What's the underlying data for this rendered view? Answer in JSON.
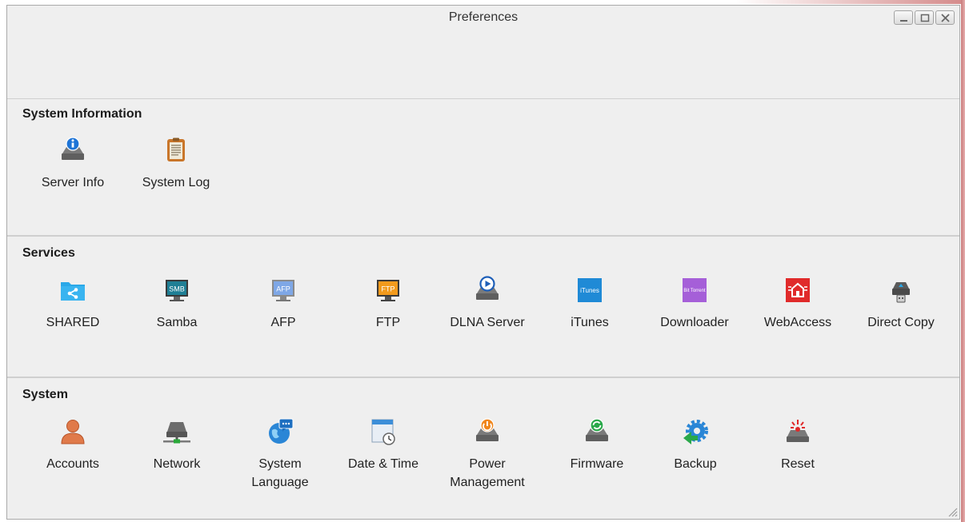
{
  "window": {
    "title": "Preferences",
    "controls": {
      "minimize": "minimize-icon",
      "maximize": "maximize-icon",
      "close": "close-icon"
    }
  },
  "sections": [
    {
      "title": "System Information",
      "items": [
        {
          "label": "Server Info",
          "icon": "server-info-icon"
        },
        {
          "label": "System Log",
          "icon": "system-log-icon"
        }
      ]
    },
    {
      "title": "Services",
      "items": [
        {
          "label": "SHARED",
          "icon": "shared-folder-icon"
        },
        {
          "label": "Samba",
          "icon": "samba-icon",
          "icon_text": "SMB"
        },
        {
          "label": "AFP",
          "icon": "afp-icon",
          "icon_text": "AFP"
        },
        {
          "label": "FTP",
          "icon": "ftp-icon",
          "icon_text": "FTP"
        },
        {
          "label": "DLNA Server",
          "icon": "dlna-server-icon"
        },
        {
          "label": "iTunes",
          "icon": "itunes-icon",
          "icon_text": "iTunes"
        },
        {
          "label": "Downloader",
          "icon": "downloader-icon",
          "icon_text": "Bit Torrent"
        },
        {
          "label": "WebAccess",
          "icon": "webaccess-icon"
        },
        {
          "label": "Direct Copy",
          "icon": "direct-copy-icon"
        }
      ]
    },
    {
      "title": "System",
      "items": [
        {
          "label": "Accounts",
          "icon": "accounts-icon"
        },
        {
          "label": "Network",
          "icon": "network-icon"
        },
        {
          "label": "System Language",
          "icon": "system-language-icon"
        },
        {
          "label": "Date & Time",
          "icon": "date-time-icon"
        },
        {
          "label": "Power Management",
          "icon": "power-management-icon"
        },
        {
          "label": "Firmware",
          "icon": "firmware-icon"
        },
        {
          "label": "Backup",
          "icon": "backup-icon"
        },
        {
          "label": "Reset",
          "icon": "reset-icon"
        }
      ]
    }
  ],
  "colors": {
    "accent_blue": "#1e74d6",
    "ftp_orange": "#f29a1c",
    "webaccess_red": "#e02a2a",
    "downloader_purple": "#a55fd8",
    "itunes_blue": "#1f8ad6",
    "samba_teal": "#1f7f95",
    "drive_gray": "#6c6c6c"
  }
}
